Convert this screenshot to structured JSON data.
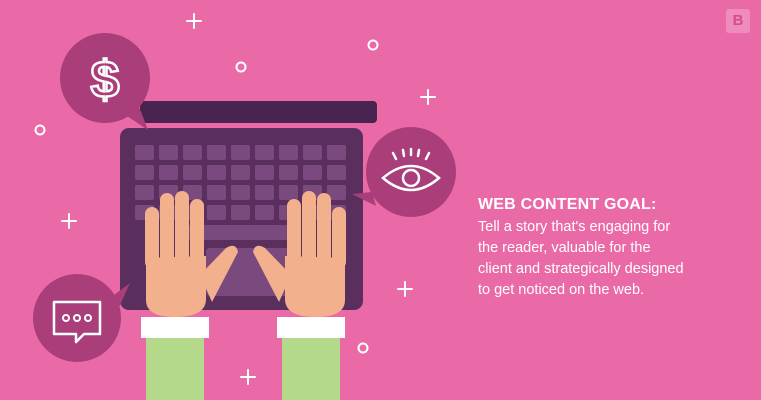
{
  "brand": {
    "logo_letter": "B"
  },
  "goal": {
    "title": "WEB CONTENT GOAL:",
    "lines": [
      "Tell a story that's engaging for",
      "the reader, valuable for the",
      "client and strategically designed",
      "to get noticed on the web."
    ]
  },
  "icons": {
    "money": "dollar-sign-icon",
    "view": "eye-icon",
    "comment": "chat-bubble-icon",
    "device": "laptop-keyboard",
    "hands": "typing-hands"
  },
  "colors": {
    "background": "#ea6aa8",
    "bubble": "#a93e7a",
    "keyboard": "#5a2f5e",
    "keys": "#7a4a7e",
    "skin": "#f2b08c",
    "cuff": "#ffffff",
    "sleeve": "#b4d98a"
  }
}
